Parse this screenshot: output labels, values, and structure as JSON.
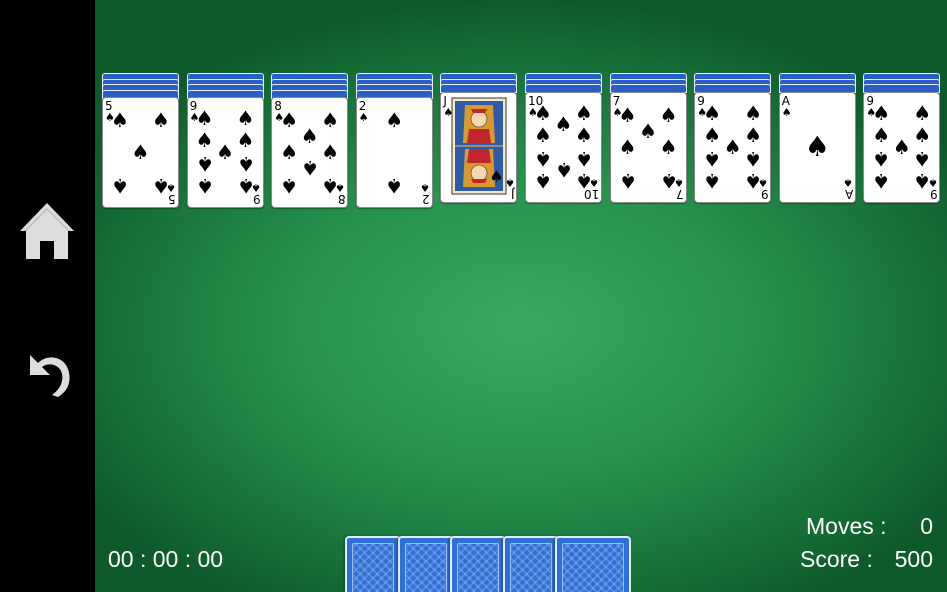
{
  "sidebar": {
    "home_icon": "home-icon",
    "undo_icon": "undo-icon"
  },
  "tableau": [
    {
      "rank": "5",
      "suit": "♠",
      "hidden": 4
    },
    {
      "rank": "9",
      "suit": "♠",
      "hidden": 4
    },
    {
      "rank": "8",
      "suit": "♠",
      "hidden": 4
    },
    {
      "rank": "2",
      "suit": "♠",
      "hidden": 4
    },
    {
      "rank": "J",
      "suit": "♠",
      "hidden": 3
    },
    {
      "rank": "10",
      "suit": "♠",
      "hidden": 3
    },
    {
      "rank": "7",
      "suit": "♠",
      "hidden": 3
    },
    {
      "rank": "9",
      "suit": "♠",
      "hidden": 3
    },
    {
      "rank": "A",
      "suit": "♠",
      "hidden": 3
    },
    {
      "rank": "9",
      "suit": "♠",
      "hidden": 3
    }
  ],
  "stock": {
    "deals_remaining": 5
  },
  "hud": {
    "timer": "00 : 00 : 00",
    "moves_label": "Moves :",
    "moves_value": "0",
    "score_label": "Score :",
    "score_value": "500"
  },
  "colors": {
    "felt": "#27934f",
    "card_back": "#2f6fd8",
    "sidebar": "#000000"
  }
}
